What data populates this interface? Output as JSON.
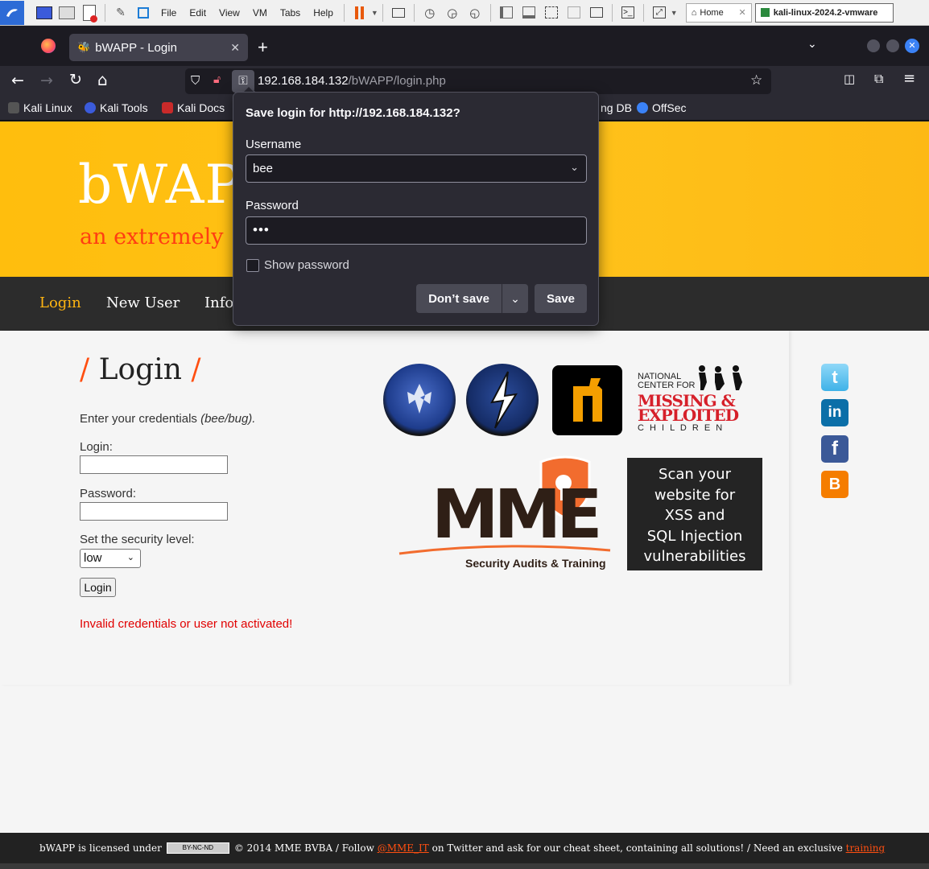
{
  "vm_toolbar": {
    "menus": [
      "File",
      "Edit",
      "View",
      "VM",
      "Tabs",
      "Help"
    ],
    "tabs": [
      {
        "label": "Home"
      },
      {
        "label": "kali-linux-2024.2-vmware"
      }
    ]
  },
  "browser": {
    "tab_title": "bWAPP - Login",
    "url_host": "192.168.184.132",
    "url_path": "/bWAPP/login.php",
    "bookmarks": [
      "Kali Linux",
      "Kali Tools",
      "Kali Docs",
      "ng DB",
      "OffSec"
    ]
  },
  "page": {
    "logo": "bWAPP",
    "subtitle": "an extremely",
    "menu": [
      "Login",
      "New User",
      "Info"
    ],
    "login_title": "Login",
    "title_slash": "/",
    "instructions": "Enter your credentials",
    "instructions_hint": "(bee/bug).",
    "login_label": "Login:",
    "password_label": "Password:",
    "security_label": "Set the security level:",
    "security_value": "low",
    "login_button": "Login",
    "error": "Invalid credentials or user not activated!",
    "ncmec": {
      "line1": "NATIONAL",
      "line2": "CENTER FOR",
      "line3": "MISSING &",
      "line4": "EXPLOITED",
      "line5": "C H I L D R E N"
    },
    "mme": {
      "name": "MME",
      "tagline": "Security Audits & Training"
    },
    "scan_box": [
      "Scan your",
      "website for",
      "XSS and",
      "SQL Injection",
      "vulnerabilities"
    ],
    "footer": {
      "text1": "bWAPP is licensed under",
      "cc": "BY-NC-ND",
      "text2": "© 2014 MME BVBA / Follow",
      "twitter_link": "@MME_IT",
      "text3": "on Twitter and ask for our cheat sheet, containing all solutions! / Need an exclusive",
      "training_link": "training"
    }
  },
  "popup": {
    "title": "Save login for http://192.168.184.132?",
    "username_label": "Username",
    "username_value": "bee",
    "password_label": "Password",
    "password_value": "•••",
    "show_password": "Show password",
    "dont_save": "Don’t save",
    "save": "Save"
  }
}
